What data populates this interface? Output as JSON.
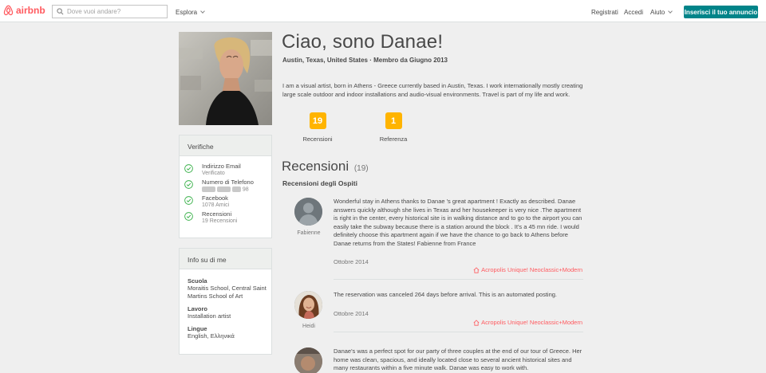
{
  "header": {
    "brand": "airbnb",
    "search_placeholder": "Dove vuoi andare?",
    "explore": "Esplora",
    "signup": "Registrati",
    "login": "Accedi",
    "help": "Aiuto",
    "host_button": "Inserisci il tuo annuncio"
  },
  "profile": {
    "name": "Ciao, sono Danae!",
    "location": "Austin, Texas, United States · Membro da Giugno 2013",
    "about": "I am a visual artist, born in Athens - Greece currently based in Austin, Texas. I work internationally mostly creating large scale outdoor and indoor installations and audio-visual environments. Travel is part of my life and work.",
    "stats": [
      {
        "value": "19",
        "label": "Recensioni"
      },
      {
        "value": "1",
        "label": "Referenza"
      }
    ]
  },
  "verifications": {
    "title": "Verifiche",
    "items": [
      {
        "title": "Indirizzo Email",
        "sub": "Verificato"
      },
      {
        "title": "Numero di Telefono",
        "sub": "98"
      },
      {
        "title": "Facebook",
        "sub": "1078 Amici"
      },
      {
        "title": "Recensioni",
        "sub": "19 Recensioni"
      }
    ]
  },
  "info": {
    "title": "Info su di me",
    "school_label": "Scuola",
    "school_value": "Moraitis School, Central Saint Martins School of Art",
    "work_label": "Lavoro",
    "work_value": "Installation artist",
    "lang_label": "Lingue",
    "lang_value": "English, Ελληνικά"
  },
  "reviews": {
    "title": "Recensioni",
    "count": "(19)",
    "subtitle": "Recensioni degli Ospiti",
    "items": [
      {
        "name": "Fabienne",
        "text": "Wonderful stay in Athens thanks to Danae 's great apartment ! Exactly as described. Danae answers quickly although she lives in Texas and her housekeeper is very nice .The apartment is right in the center, every historical site is in walking distance and to go to the airport you can easily take the subway because there is a station around the block . It's a 45 mn ride. I would definitely choose this apartment again if we have the chance to go back to Athens before Danae returns from the States! Fabienne from France",
        "date": "Ottobre 2014",
        "listing": "Acropolis Unique! Neoclassic+Modern"
      },
      {
        "name": "Heidi",
        "text": "The reservation was canceled 264 days before arrival. This is an automated posting.",
        "date": "Ottobre 2014",
        "listing": "Acropolis Unique! Neoclassic+Modern"
      },
      {
        "name": "",
        "text": "Danae's was a perfect spot for our party of three couples at the end of our tour of Greece. Her home was clean, spacious, and ideally located close to several ancient historical sites and many restaurants within a five minute walk. Danae was easy to work with.",
        "date": "",
        "listing": ""
      }
    ]
  },
  "colors": {
    "brand": "#ff5a5f",
    "teal": "#008489",
    "badge": "#ffb400",
    "verified": "#3fb34f"
  }
}
